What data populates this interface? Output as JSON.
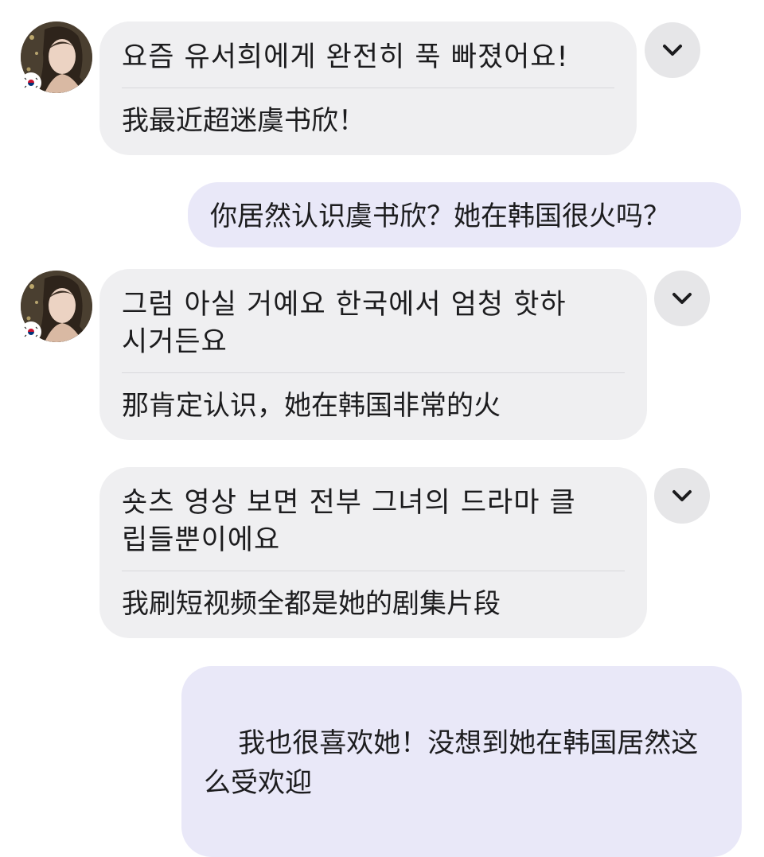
{
  "messages": [
    {
      "direction": "incoming",
      "original": "요즘 유서희에게 완전히 푹 빠졌어요!",
      "translation": "我最近超迷虞书欣！"
    },
    {
      "direction": "outgoing",
      "text": "你居然认识虞书欣？她在韩国很火吗？"
    },
    {
      "direction": "incoming",
      "original": "그럼 아실 거예요 한국에서 엄청 핫하\n시거든요",
      "translation": "那肯定认识，她在韩国非常的火"
    },
    {
      "direction": "incoming",
      "original": "숏츠 영상 보면 전부 그녀의 드라마 클\n립들뿐이에요",
      "translation": "我刷短视频全都是她的剧集片段"
    },
    {
      "direction": "outgoing",
      "text": "我也很喜欢她！没想到她在韩国居然这\n么受欢迎"
    }
  ],
  "icons": {
    "expand": "chevron-down-icon",
    "flag": "south-korea-flag-icon"
  },
  "colors": {
    "incoming_bubble": "#efeff1",
    "outgoing_bubble": "#e9e8f8",
    "expand_button": "#e6e6e8"
  }
}
